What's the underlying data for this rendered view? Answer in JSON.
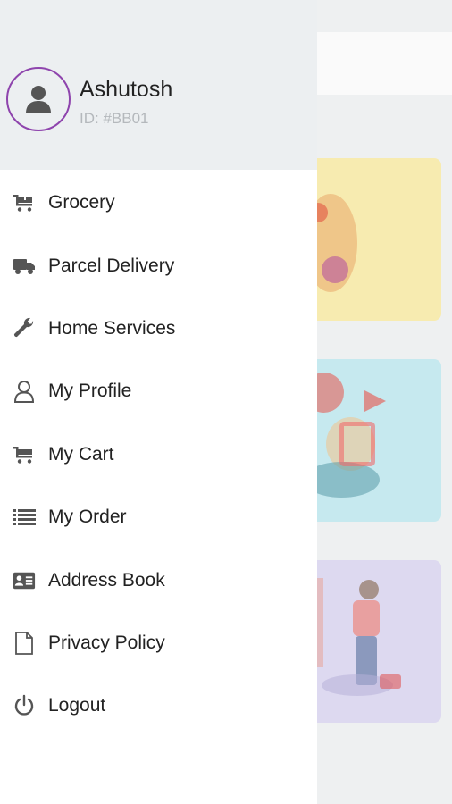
{
  "user": {
    "name": "Ashutosh",
    "id": "ID: #BB01"
  },
  "menu": [
    {
      "label": "Grocery",
      "icon": "cart-plus-icon"
    },
    {
      "label": "Parcel Delivery",
      "icon": "truck-icon"
    },
    {
      "label": "Home Services",
      "icon": "wrench-icon"
    },
    {
      "label": "My Profile",
      "icon": "user-outline-icon"
    },
    {
      "label": "My Cart",
      "icon": "cart-icon"
    },
    {
      "label": "My Order",
      "icon": "list-icon"
    },
    {
      "label": "Address Book",
      "icon": "address-card-icon"
    },
    {
      "label": "Privacy Policy",
      "icon": "document-icon"
    },
    {
      "label": "Logout",
      "icon": "power-icon"
    }
  ],
  "colors": {
    "avatar_ring": "#8e44ad",
    "header_bg": "#eceff1",
    "icon": "#555555"
  }
}
